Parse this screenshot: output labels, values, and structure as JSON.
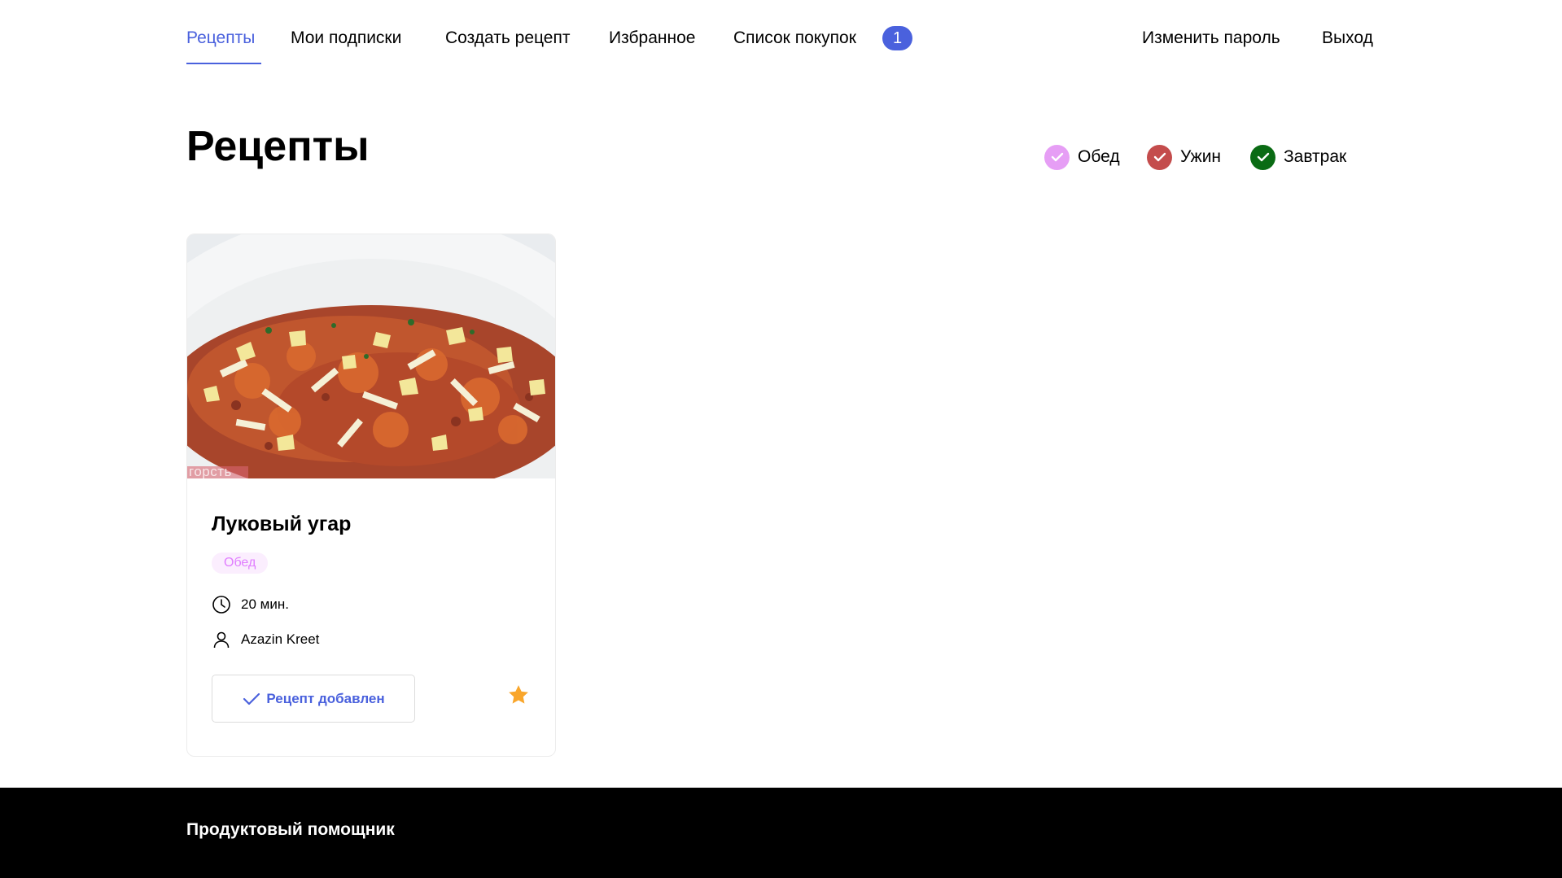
{
  "nav": {
    "items": [
      {
        "label": "Рецепты",
        "active": true
      },
      {
        "label": "Мои подписки"
      },
      {
        "label": "Создать рецепт"
      },
      {
        "label": "Избранное"
      },
      {
        "label": "Список покупок"
      }
    ],
    "cart_count": "1",
    "change_password": "Изменить пароль",
    "logout": "Выход"
  },
  "page": {
    "title": "Рецепты"
  },
  "filters": [
    {
      "label": "Обед",
      "color": "#e69ef5"
    },
    {
      "label": "Ужин",
      "color": "#c44c4c"
    },
    {
      "label": "Завтрак",
      "color": "#0a6b14"
    }
  ],
  "recipe": {
    "title": "Луковый угар",
    "image_watermark": "горсть",
    "tag": "Обед",
    "time": "20 мин.",
    "author": "Azazin Kreet",
    "added_label": "Рецепт добавлен",
    "favorited": true,
    "icons": {
      "time": "clock-icon",
      "author": "user-icon",
      "added": "check-icon",
      "favorite": "star-icon"
    }
  },
  "colors": {
    "accent": "#4a61dd",
    "star": "#f9a62b",
    "tag_bg": "#fbeefe",
    "tag_text": "#e07dff"
  },
  "footer": {
    "brand": "Продуктовый помощник"
  }
}
